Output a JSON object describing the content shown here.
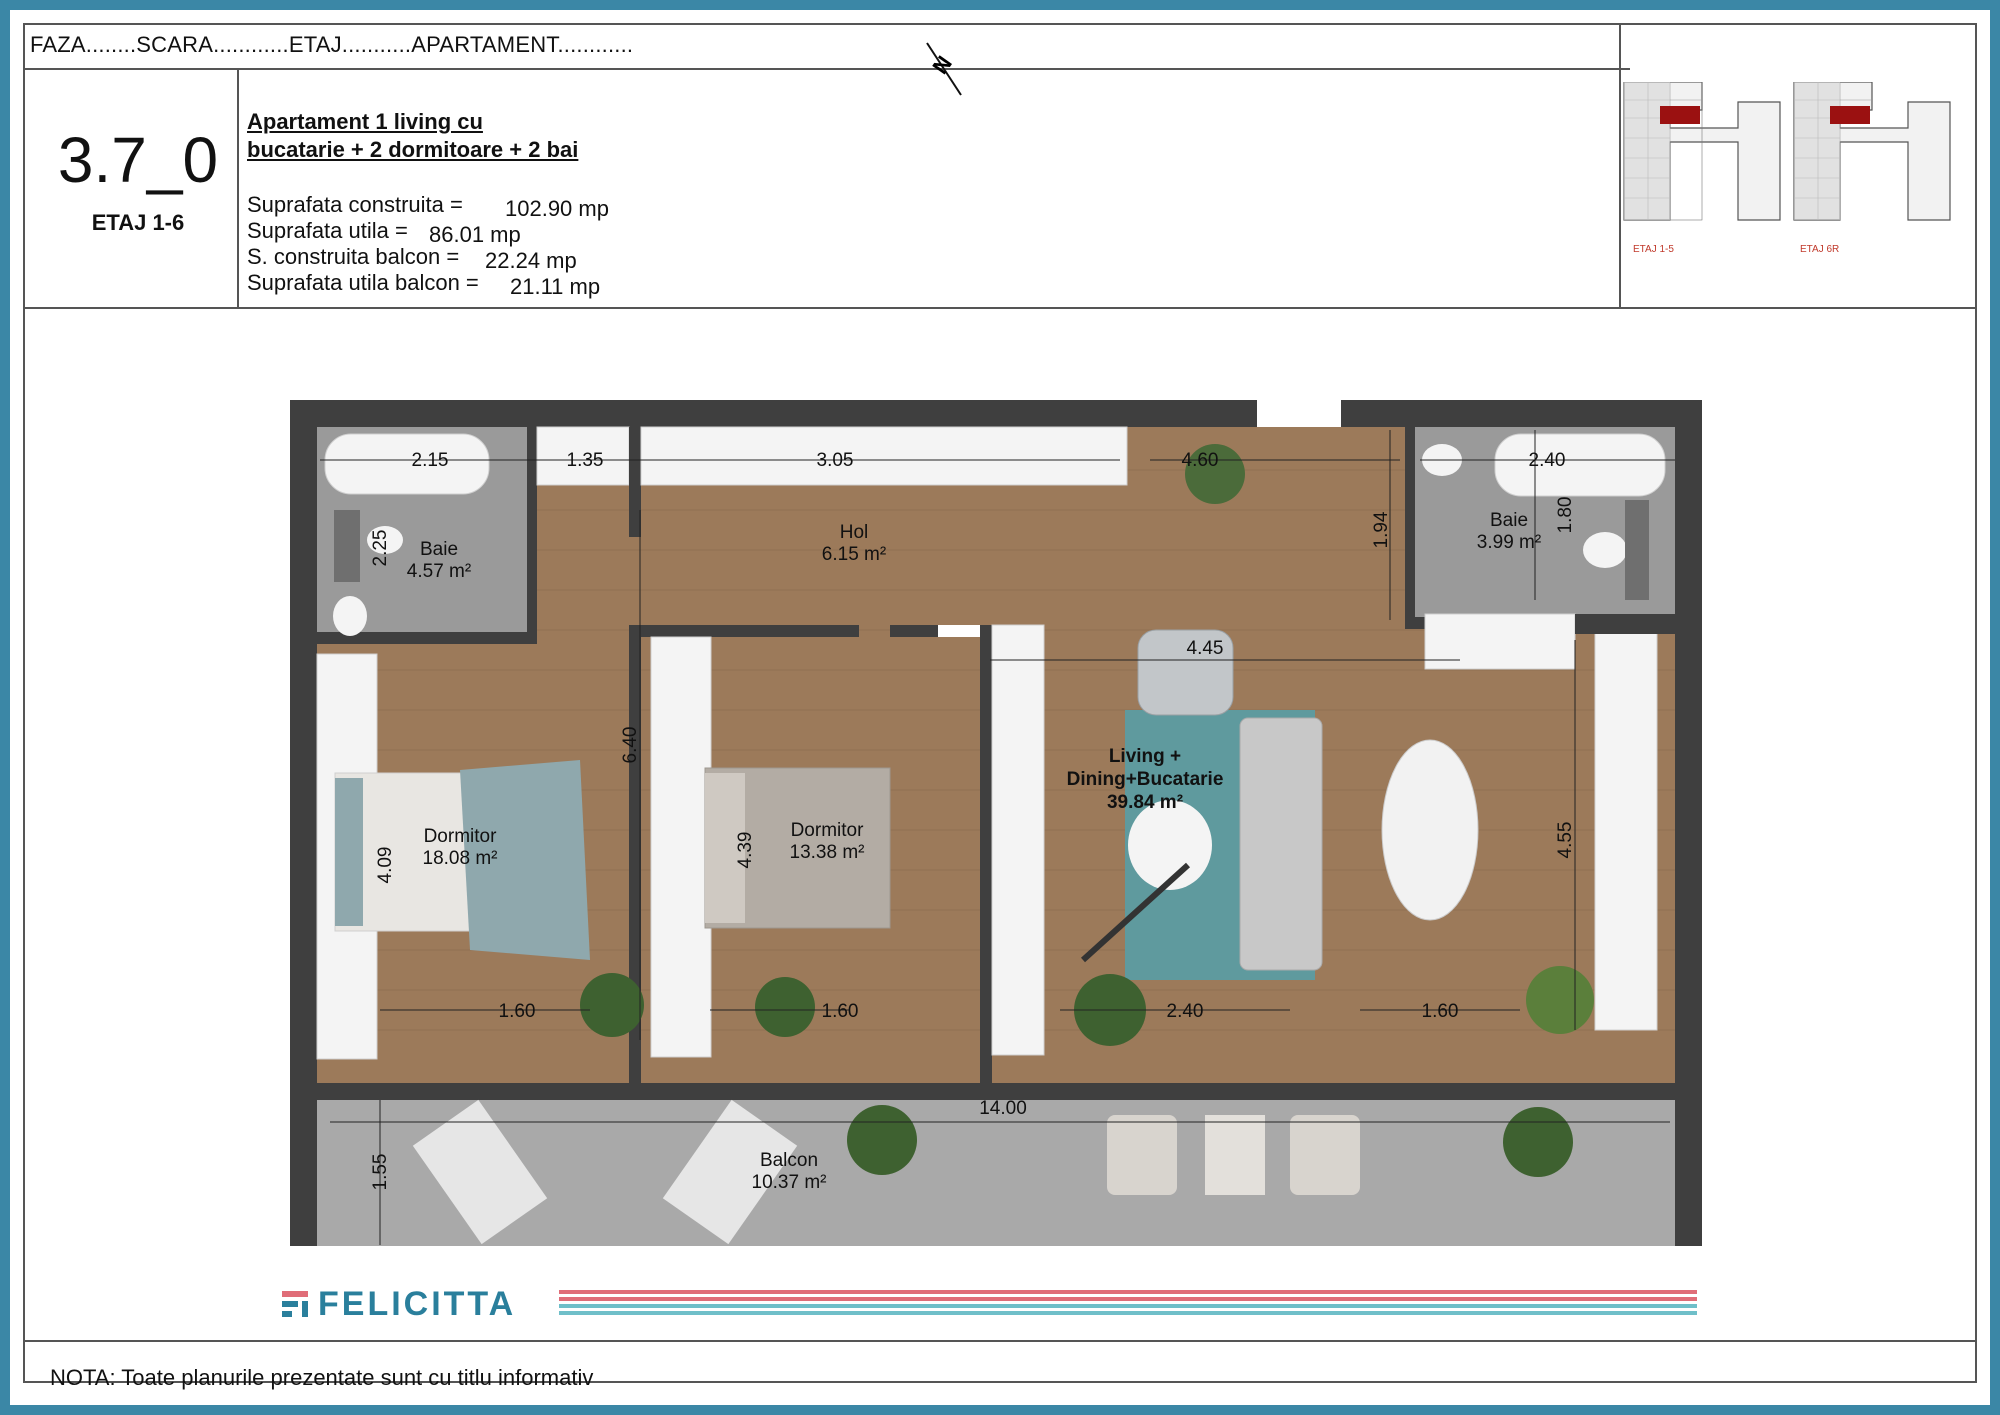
{
  "header": {
    "faza_line": "FAZA........SCARA............ETAJ...........APARTAMENT............",
    "apartment_code": "3.7_0",
    "floors": "ETAJ 1-6",
    "title_line1": "Apartament 1 living cu",
    "title_line2": "bucatarie + 2 dormitoare + 2 bai",
    "specs": [
      {
        "label": "Suprafata construita =",
        "value": "102.90 mp"
      },
      {
        "label": "Suprafata utila =",
        "value": "86.01 mp"
      },
      {
        "label": "S. construita balcon =",
        "value": "22.24 mp"
      },
      {
        "label": "Suprafata utila balcon =",
        "value": "21.11 mp"
      }
    ],
    "compass_letter": "N"
  },
  "keyplans": [
    {
      "label": "ETAJ 1-5"
    },
    {
      "label": "ETAJ 6R"
    }
  ],
  "rooms": [
    {
      "name": "Baie",
      "area": "4.57 m²"
    },
    {
      "name": "Hol",
      "area": "6.15 m²"
    },
    {
      "name": "Baie",
      "area": "3.99 m²"
    },
    {
      "name": "Dormitor",
      "area": "18.08 m²"
    },
    {
      "name": "Dormitor",
      "area": "13.38 m²"
    },
    {
      "name": "Living +",
      "name2": "Dining+Bucatarie",
      "area": "39.84 m²"
    },
    {
      "name": "Balcon",
      "area": "10.37 m²"
    }
  ],
  "dimensions": {
    "d1": "2.15",
    "d2": "1.35",
    "d3": "3.05",
    "d4": "4.60",
    "d5": "2.40",
    "d6": "2.25",
    "d7": "1.94",
    "d8": "1.80",
    "d9": "4.45",
    "d10": "6.40",
    "d11": "4.09",
    "d12": "4.39",
    "d13": "4.55",
    "d14": "1.60",
    "d15": "1.60",
    "d16": "2.40",
    "d17": "1.60",
    "d18": "14.00",
    "d19": "1.55"
  },
  "brand": {
    "name": "FELICITTA"
  },
  "colors": {
    "frame": "#3b87a6",
    "wall": "#3f3f3f",
    "floor_wood": "#9c7a5a",
    "tile": "#9a9a9a",
    "rug": "#5f9a9e",
    "keyplan_highlight": "#9b1111",
    "stripe_red": "#e06d78",
    "stripe_teal": "#6fbfc9"
  },
  "footer": {
    "note": "NOTA: Toate planurile prezentate sunt cu titlu informativ"
  }
}
